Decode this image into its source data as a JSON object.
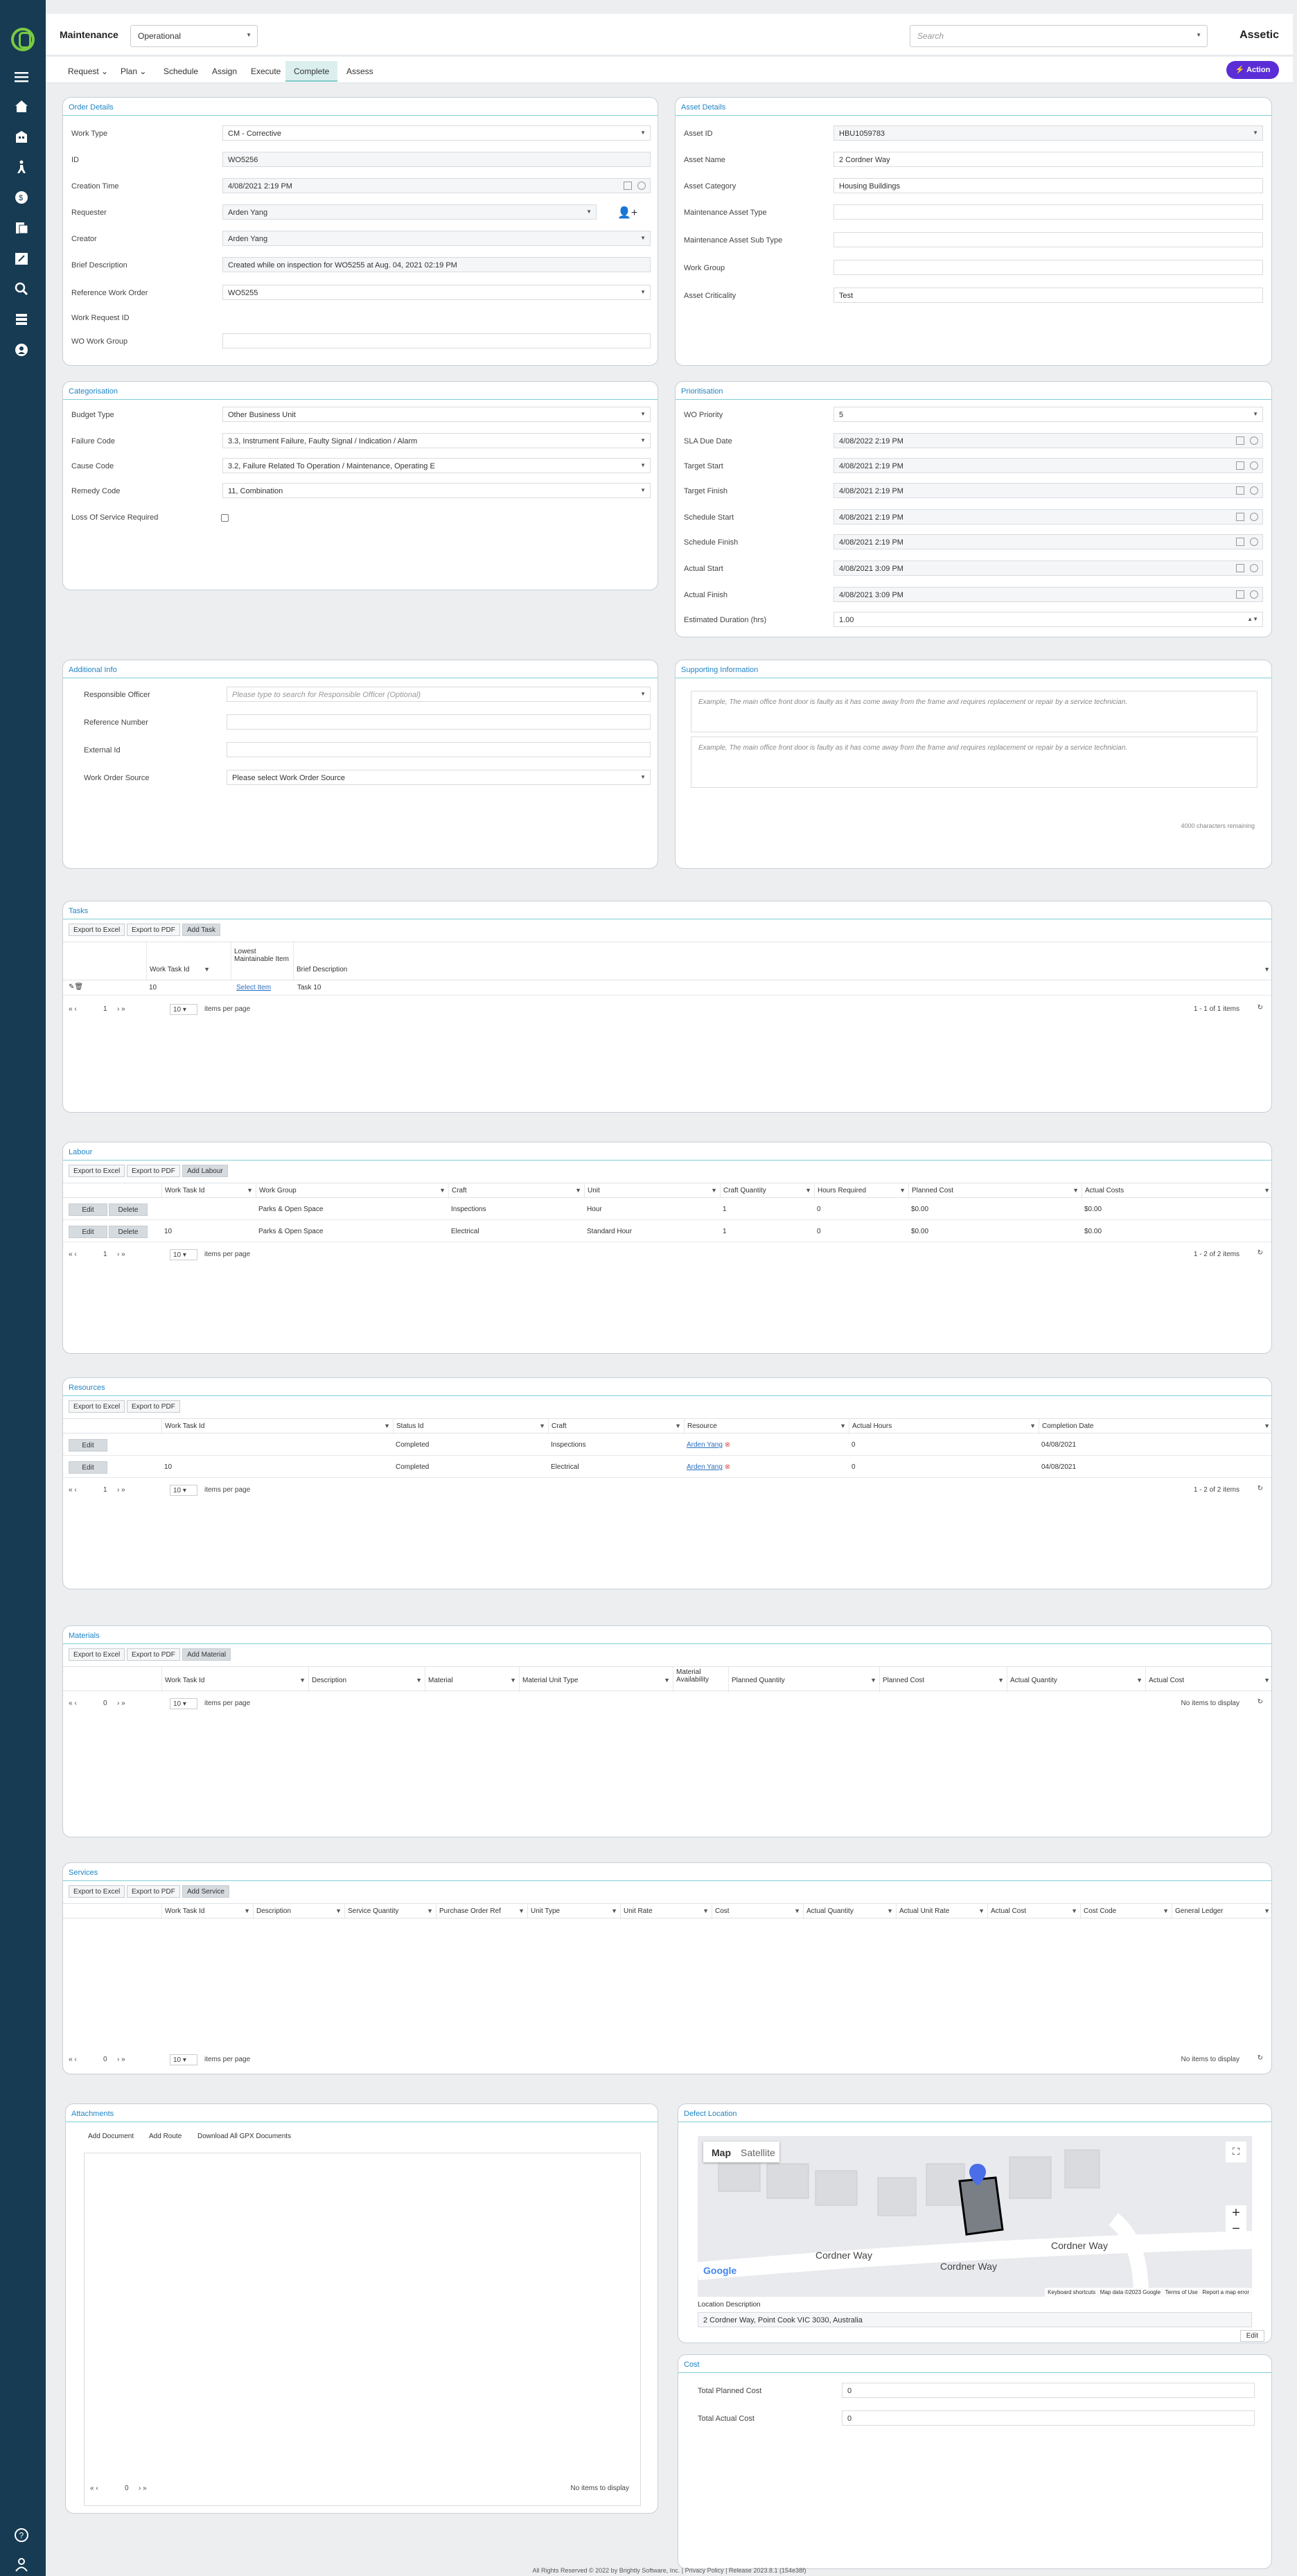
{
  "app": {
    "title": "Maintenance",
    "mode": "Operational",
    "search_placeholder": "Search",
    "brand": "Assetic"
  },
  "nav": {
    "tabs": [
      "Request",
      "Plan",
      "Schedule",
      "Assign",
      "Execute",
      "Complete",
      "Assess"
    ],
    "active": "Complete",
    "action_label": "Action"
  },
  "order_details": {
    "title": "Order Details",
    "fields": [
      {
        "label": "Work Type",
        "value": "CM - Corrective"
      },
      {
        "label": "ID",
        "value": "WO5256"
      },
      {
        "label": "Creation Time",
        "value": "4/08/2021 2:19 PM"
      },
      {
        "label": "Requester",
        "value": "Arden Yang"
      },
      {
        "label": "Creator",
        "value": "Arden Yang"
      },
      {
        "label": "Brief Description",
        "value": "Created while on inspection for WO5255 at Aug. 04, 2021 02:19 PM"
      },
      {
        "label": "Reference Work Order",
        "value": "WO5255"
      },
      {
        "label": "Work Request ID",
        "value": ""
      },
      {
        "label": "WO Work Group",
        "value": ""
      }
    ]
  },
  "asset_details": {
    "title": "Asset Details",
    "fields": [
      {
        "label": "Asset ID",
        "value": "HBU1059783"
      },
      {
        "label": "Asset Name",
        "value": "2 Cordner Way"
      },
      {
        "label": "Asset Category",
        "value": "Housing Buildings"
      },
      {
        "label": "Maintenance Asset Type",
        "value": ""
      },
      {
        "label": "Maintenance Asset Sub Type",
        "value": ""
      },
      {
        "label": "Work Group",
        "value": ""
      },
      {
        "label": "Asset Criticality",
        "value": "Test"
      }
    ]
  },
  "categorisation": {
    "title": "Categorisation",
    "fields": [
      {
        "label": "Budget Type",
        "value": "Other Business Unit"
      },
      {
        "label": "Failure Code",
        "value": "3.3, Instrument Failure, Faulty Signal / Indication / Alarm"
      },
      {
        "label": "Cause Code",
        "value": "3.2, Failure Related To Operation / Maintenance, Operating E"
      },
      {
        "label": "Remedy Code",
        "value": "11, Combination"
      },
      {
        "label": "Loss Of Service Required",
        "value": ""
      }
    ]
  },
  "prioritisation": {
    "title": "Prioritisation",
    "fields": [
      {
        "label": "WO Priority",
        "value": "5"
      },
      {
        "label": "SLA Due Date",
        "value": "4/08/2022 2:19 PM"
      },
      {
        "label": "Target Start",
        "value": "4/08/2021 2:19 PM"
      },
      {
        "label": "Target Finish",
        "value": "4/08/2021 2:19 PM"
      },
      {
        "label": "Schedule Start",
        "value": "4/08/2021 2:19 PM"
      },
      {
        "label": "Schedule Finish",
        "value": "4/08/2021 2:19 PM"
      },
      {
        "label": "Actual Start",
        "value": "4/08/2021 3:09 PM"
      },
      {
        "label": "Actual Finish",
        "value": "4/08/2021 3:09 PM"
      },
      {
        "label": "Estimated Duration (hrs)",
        "value": "1.00"
      }
    ]
  },
  "additional_info": {
    "title": "Additional Info",
    "fields": [
      {
        "label": "Responsible Officer",
        "value": "Please type to search for Responsible Officer (Optional)"
      },
      {
        "label": "Reference Number",
        "value": ""
      },
      {
        "label": "External Id",
        "value": ""
      },
      {
        "label": "Work Order Source",
        "value": "Please select Work Order Source"
      }
    ]
  },
  "supporting": {
    "title": "Supporting Information",
    "placeholder1": "Example, The main office front door is faulty as it has come away from the frame and requires replacement or repair by a service technician.",
    "placeholder2": "Example, The main office front door is faulty as it has come away from the frame and requires replacement or repair by a service technician.",
    "remaining": "4000 characters remaining"
  },
  "tasks": {
    "title": "Tasks",
    "buttons": [
      "Export to Excel",
      "Export to PDF",
      "Add Task"
    ],
    "columns": [
      "Work Task Id",
      "Lowest Maintainable Item",
      "Brief Description"
    ],
    "rows": [
      {
        "id": "10",
        "item": "Select Item",
        "desc": "Task 10"
      }
    ],
    "page": "1",
    "per_page": "10",
    "per_page_label": "items per page",
    "summary": "1 - 1 of 1 items"
  },
  "labour": {
    "title": "Labour",
    "buttons": [
      "Export to Excel",
      "Export to PDF",
      "Add Labour"
    ],
    "columns": [
      "Work Task Id",
      "Work Group",
      "Craft",
      "Unit",
      "Craft Quantity",
      "Hours Required",
      "Planned Cost",
      "Actual Costs"
    ],
    "rows": [
      {
        "id": "",
        "group": "Parks & Open Space",
        "craft": "Inspections",
        "unit": "Hour",
        "qty": "1",
        "hours": "0",
        "planned": "$0.00",
        "actual": "$0.00"
      },
      {
        "id": "10",
        "group": "Parks & Open Space",
        "craft": "Electrical",
        "unit": "Standard Hour",
        "qty": "1",
        "hours": "0",
        "planned": "$0.00",
        "actual": "$0.00"
      }
    ],
    "edit": "Edit",
    "delete": "Delete",
    "page": "1",
    "per_page": "10",
    "per_page_label": "items per page",
    "summary": "1 - 2 of 2 items"
  },
  "resources": {
    "title": "Resources",
    "buttons": [
      "Export to Excel",
      "Export to PDF"
    ],
    "columns": [
      "Work Task Id",
      "Status Id",
      "Craft",
      "Resource",
      "Actual Hours",
      "Completion Date"
    ],
    "rows": [
      {
        "id": "",
        "status": "Completed",
        "craft": "Inspections",
        "resource": "Arden Yang",
        "hours": "0",
        "date": "04/08/2021"
      },
      {
        "id": "10",
        "status": "Completed",
        "craft": "Electrical",
        "resource": "Arden Yang",
        "hours": "0",
        "date": "04/08/2021"
      }
    ],
    "edit": "Edit",
    "page": "1",
    "per_page": "10",
    "per_page_label": "items per page",
    "summary": "1 - 2 of 2 items"
  },
  "materials": {
    "title": "Materials",
    "buttons": [
      "Export to Excel",
      "Export to PDF",
      "Add Material"
    ],
    "columns": [
      "Work Task Id",
      "Description",
      "Material",
      "Material Unit Type",
      "Material Availability",
      "Planned Quantity",
      "Planned Cost",
      "Actual Quantity",
      "Actual Cost"
    ],
    "page": "0",
    "per_page": "10",
    "per_page_label": "items per page",
    "summary": "No items to display"
  },
  "services": {
    "title": "Services",
    "buttons": [
      "Export to Excel",
      "Export to PDF",
      "Add Service"
    ],
    "columns": [
      "Work Task Id",
      "Description",
      "Service Quantity",
      "Purchase Order Ref",
      "Unit Type",
      "Unit Rate",
      "Cost",
      "Actual Quantity",
      "Actual Unit Rate",
      "Actual Cost",
      "Cost Code",
      "General Ledger"
    ],
    "page": "0",
    "per_page": "10",
    "per_page_label": "items per page",
    "summary": "No items to display"
  },
  "attachments": {
    "title": "Attachments",
    "buttons": [
      "Add Document",
      "Add Route",
      "Download All GPX Documents"
    ],
    "page": "0",
    "summary": "No items to display"
  },
  "defect": {
    "title": "Defect Location",
    "map_tab": "Map",
    "sat_tab": "Satellite",
    "street1": "Cordner Way",
    "street2": "Cordner Way",
    "street3": "Cordner Way",
    "map_footer": [
      "Keyboard shortcuts",
      "Map data ©2023 Google",
      "Terms of Use",
      "Report a map error"
    ],
    "google": "Google",
    "loc_label": "Location Description",
    "loc_value": "2 Cordner Way, Point Cook VIC 3030, Australia",
    "edit": "Edit"
  },
  "cost": {
    "title": "Cost",
    "fields": [
      {
        "label": "Total Planned Cost",
        "value": "0"
      },
      {
        "label": "Total Actual Cost",
        "value": "0"
      }
    ]
  },
  "footer": {
    "text": "All Rights Reserved © 2022 by Brightly Software, Inc. | Privacy Policy | Release 2023.8.1 (154e38f)"
  },
  "colors": {
    "accent": "#2185c5",
    "sidebar": "#163b52",
    "action": "#5b2dd6",
    "logo": "#7ac943"
  }
}
